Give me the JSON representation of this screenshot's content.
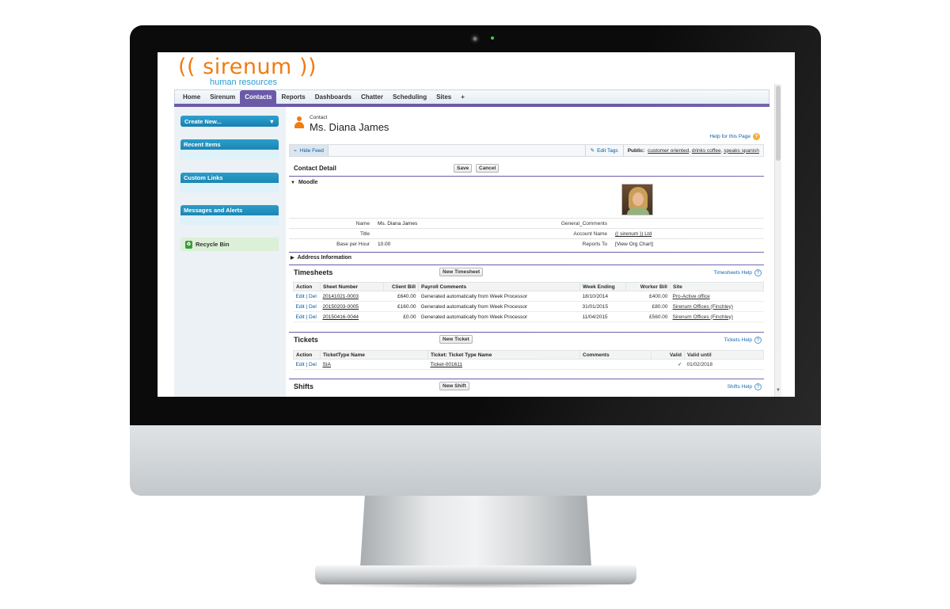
{
  "brand": {
    "logo_text": "(( sirenum ))",
    "tagline": "human resources",
    "orange": "#f07c12",
    "blue": "#2b9bd2",
    "tab_active_color": "#6b5aa8"
  },
  "tabs": [
    {
      "label": "Home"
    },
    {
      "label": "Sirenum"
    },
    {
      "label": "Contacts",
      "active": true
    },
    {
      "label": "Reports"
    },
    {
      "label": "Dashboards"
    },
    {
      "label": "Chatter"
    },
    {
      "label": "Scheduling"
    },
    {
      "label": "Sites"
    },
    {
      "label": "+"
    }
  ],
  "sidebar": {
    "create_new": "Create New...",
    "recent_items": "Recent Items",
    "custom_links": "Custom Links",
    "messages_alerts": "Messages and Alerts",
    "recycle_bin": "Recycle Bin"
  },
  "header": {
    "entity_label": "Contact",
    "title": "Ms. Diana James",
    "help_link": "Help for this Page"
  },
  "feed": {
    "hide_feed": "Hide Feed",
    "edit_tags": "Edit Tags",
    "public_label": "Public:",
    "tags": [
      "customer oriented",
      "drinks coffee",
      "speaks spanish"
    ]
  },
  "detail": {
    "heading": "Contact Detail",
    "save": "Save",
    "cancel": "Cancel",
    "moodle": "Moodle",
    "fields_left": [
      {
        "label": "Name",
        "value": "Ms. Diana James"
      },
      {
        "label": "Title",
        "value": ""
      },
      {
        "label": "Base per Hour",
        "value": "10.00"
      }
    ],
    "fields_right": [
      {
        "label": "General_Comments",
        "value": ""
      },
      {
        "label": "Account Name",
        "value": "(( sirenum )) Ltd"
      },
      {
        "label": "Reports To",
        "value": "[View Org Chart]"
      }
    ],
    "address_section": "Address Information"
  },
  "timesheets": {
    "title": "Timesheets",
    "new_button": "New Timesheet",
    "help": "Timesheets Help",
    "columns": [
      "Action",
      "Sheet Number",
      "Client Bill",
      "Payroll Comments",
      "Week Ending",
      "Worker Bill",
      "Site"
    ],
    "rows": [
      {
        "edit": "Edit",
        "del": "Del",
        "sheet": "20141021-0003",
        "client_bill": "£640.00",
        "comments": "Generated automatically from Week Processor",
        "week_ending": "18/10/2014",
        "worker_bill": "£400.00",
        "site": "Pro-Active office"
      },
      {
        "edit": "Edit",
        "del": "Del",
        "sheet": "20150203-0005",
        "client_bill": "£160.00",
        "comments": "Generated automatically from Week Processor",
        "week_ending": "31/01/2015",
        "worker_bill": "£80.00",
        "site": "Sirenum Offices (Finchley)"
      },
      {
        "edit": "Edit",
        "del": "Del",
        "sheet": "20150416-0044",
        "client_bill": "£0.00",
        "comments": "Generated automatically from Week Processor",
        "week_ending": "11/04/2015",
        "worker_bill": "£560.00",
        "site": "Sirenum Offices (Finchley)"
      }
    ]
  },
  "tickets": {
    "title": "Tickets",
    "new_button": "New Ticket",
    "help": "Tickets Help",
    "columns": [
      "Action",
      "TicketType Name",
      "Ticket: Ticket Type Name",
      "Comments",
      "Valid",
      "Valid until"
    ],
    "rows": [
      {
        "edit": "Edit",
        "del": "Del",
        "type": "SIA",
        "ticket": "Ticket-001611",
        "comments": "",
        "valid": "✓",
        "valid_until": "01/02/2018"
      }
    ]
  },
  "shifts": {
    "title": "Shifts",
    "new_button": "New Shift",
    "help": "Shifts Help"
  }
}
